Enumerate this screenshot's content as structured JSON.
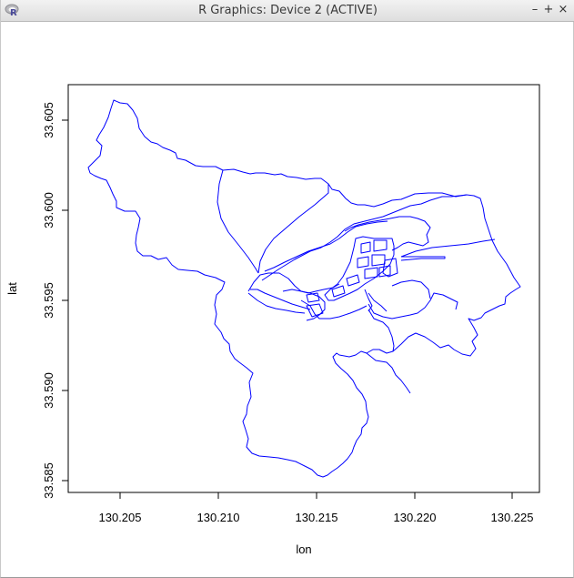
{
  "window": {
    "title": "R Graphics: Device 2 (ACTIVE)",
    "buttons": {
      "minimize": "–",
      "maximize": "+",
      "close": "×"
    }
  },
  "plot": {
    "xlabel": "lon",
    "ylabel": "lat",
    "x_ticks": [
      "130.205",
      "130.210",
      "130.215",
      "130.220",
      "130.225"
    ],
    "y_ticks": [
      "33.585",
      "33.590",
      "33.595",
      "33.600",
      "33.605"
    ],
    "line_color": "#0000ff"
  },
  "chart_data": {
    "type": "line",
    "xlabel": "lon",
    "ylabel": "lat",
    "xlim": [
      130.2023,
      130.2263
    ],
    "ylim": [
      33.5843,
      33.6071
    ],
    "series": [
      {
        "values_note": "",
        "x": [
          130.2046,
          130.2054,
          130.2065,
          130.2072,
          130.2079,
          130.2088,
          130.2097,
          130.2108,
          130.2121,
          130.2135,
          130.2148,
          130.2162,
          130.2176,
          130.2189,
          130.22,
          130.2214,
          130.2225,
          130.2228,
          130.2229
        ],
        "y": [
          33.6062,
          33.6051,
          33.6038,
          33.6026,
          33.6015,
          33.6011,
          33.601,
          33.6008,
          33.6004,
          33.6007,
          33.6005,
          33.6001,
          33.5998,
          33.5994,
          33.5992,
          33.6004,
          33.6,
          33.5986,
          33.5966
        ]
      }
    ]
  }
}
